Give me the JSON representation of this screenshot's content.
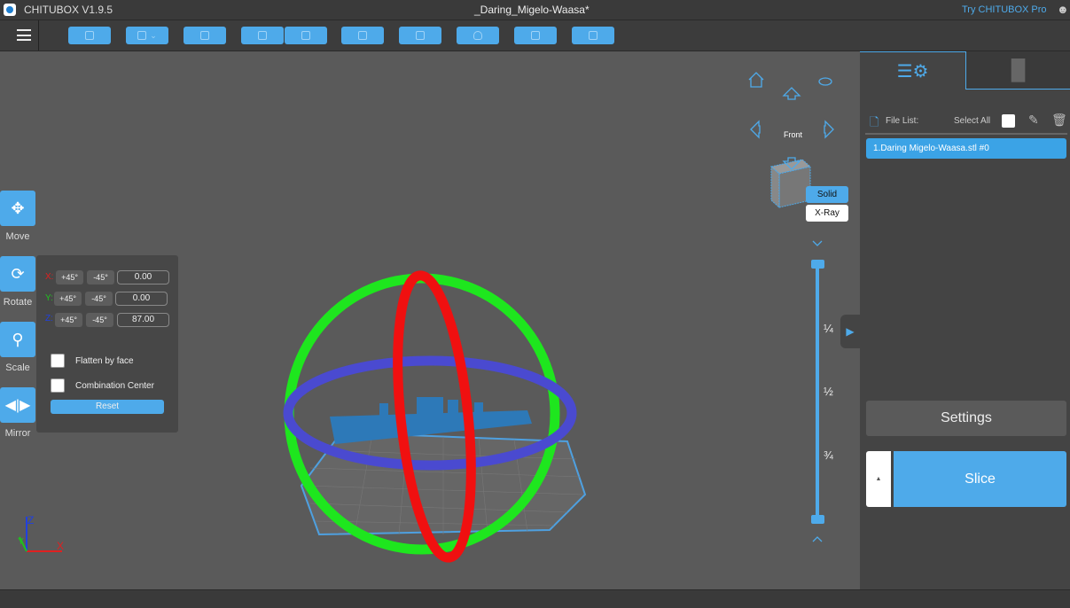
{
  "app": {
    "title": "CHITUBOX V1.9.5",
    "document": "_Daring_Migelo-Waasa*",
    "try_pro": "Try CHITUBOX Pro"
  },
  "toolbar": {
    "buttons": [
      "open-file",
      "save",
      "auto-layout",
      "import",
      "export",
      "copy",
      "support",
      "hollow",
      "dig-hole",
      "package"
    ]
  },
  "tools": [
    {
      "label": "Move"
    },
    {
      "label": "Rotate"
    },
    {
      "label": "Scale"
    },
    {
      "label": "Mirror"
    }
  ],
  "rotate": {
    "axes": [
      {
        "axis": "X:",
        "plus": "+45°",
        "minus": "-45°",
        "value": "0.00",
        "color": "#e02020"
      },
      {
        "axis": "Y:",
        "plus": "+45°",
        "minus": "-45°",
        "value": "0.00",
        "color": "#20c020"
      },
      {
        "axis": "Z:",
        "plus": "+45°",
        "minus": "-45°",
        "value": "87.00",
        "color": "#2040e0"
      }
    ],
    "flatten": "Flatten by face",
    "combination": "Combination Center",
    "reset": "Reset"
  },
  "viewcube": {
    "front": "Front"
  },
  "render_mode": {
    "solid": "Solid",
    "xray": "X-Ray"
  },
  "slider": {
    "q1": "¼",
    "q2": "½",
    "q3": "¾"
  },
  "axes_gizmo": {
    "x": "X",
    "y": "Y",
    "z": "Z"
  },
  "right": {
    "file_list": "File List:",
    "select_all": "Select All",
    "files": [
      "1.Daring Migelo-Waasa.stl #0"
    ],
    "settings": "Settings",
    "slice": "Slice"
  }
}
